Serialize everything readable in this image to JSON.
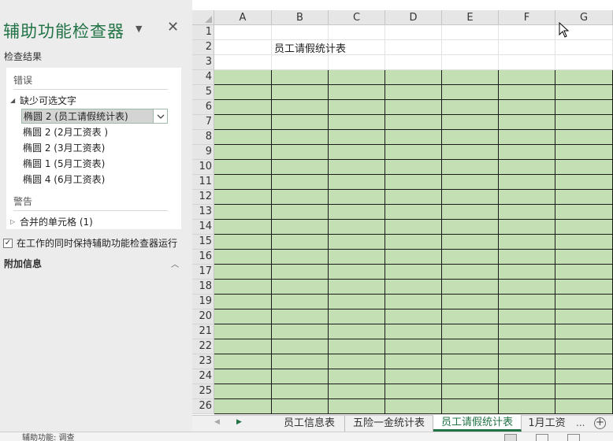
{
  "pane": {
    "title": "辅助功能检查器",
    "menu_icon": "chevron-down-icon",
    "close_icon": "close-icon",
    "results_heading": "检查结果",
    "errors_heading": "错误",
    "category_missing_alt": "缺少可选文字",
    "issues": [
      "椭圆 2 (员工请假统计表)",
      "椭圆 2 (2月工资表 )",
      "椭圆 2 (3月工资表)",
      "椭圆 1 (5月工资表)",
      "椭圆 4 (6月工资表)"
    ],
    "selected_issue_index": 0,
    "warnings_heading": "警告",
    "category_merged": "合并的单元格 (1)",
    "keep_running_label": "在工作的同时保持辅助功能检查器运行",
    "keep_running_checked": true,
    "additional_info_heading": "附加信息"
  },
  "sheet": {
    "columns": [
      "A",
      "B",
      "C",
      "D",
      "E",
      "F",
      "G"
    ],
    "rows": [
      "1",
      "2",
      "3",
      "4",
      "5",
      "6",
      "7",
      "8",
      "9",
      "10",
      "11",
      "12",
      "13",
      "14",
      "15",
      "16",
      "17",
      "18",
      "19",
      "20",
      "21",
      "22",
      "23",
      "24",
      "25",
      "26"
    ],
    "title_cell_text": "员工请假统计表",
    "table_fill_color": "#c5dfb4"
  },
  "tabs": {
    "items": [
      "员工信息表",
      "五险一金统计表",
      "员工请假统计表",
      "1月工资"
    ],
    "active_index": 2,
    "more_label": "...",
    "add_label": "+"
  },
  "status": {
    "text": "辅助功能: 调查"
  },
  "colors": {
    "accent": "#217346",
    "pane_background": "#ececec"
  }
}
